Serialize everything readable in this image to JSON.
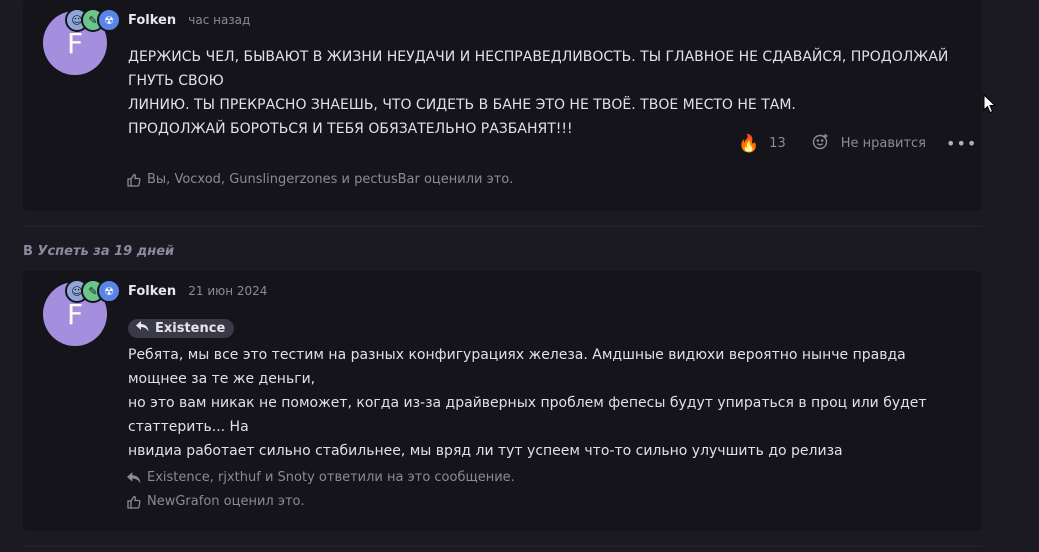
{
  "post1": {
    "avatar_letter": "F",
    "username": "Folken",
    "time": "час назад",
    "text_lines": [
      "ДЕРЖИСЬ ЧЕЛ, БЫВАЮТ В ЖИЗНИ НЕУДАЧИ И НЕСПРАВЕДЛИВОСТЬ. ТЫ ГЛАВНОЕ НЕ СДАВАЙСЯ, ПРОДОЛЖАЙ ГНУТЬ СВОЮ",
      "ЛИНИЮ. ТЫ ПРЕКРАСНО ЗНАЕШЬ, ЧТО СИДЕТЬ В БАНЕ ЭТО НЕ ТВОЁ. ТВОЕ МЕСТО НЕ ТАМ.",
      "ПРОДОЛЖАЙ БОРОТЬСЯ И ТЕБЯ ОБЯЗАТЕЛЬНО РАЗБАНЯТ!!!"
    ],
    "reaction_emoji": "🔥",
    "reaction_count": "13",
    "dislike_label": "Не нравится",
    "more_label": "•••",
    "liked_by": "Вы, Vocxod, Gunslingerzones и pectusBar оценили это."
  },
  "section": {
    "prefix": "В",
    "topic": "Успеть за 19 дней"
  },
  "post2": {
    "avatar_letter": "F",
    "username": "Folken",
    "time": "21 июн 2024",
    "quote_author": "Existence",
    "text_lines": [
      "Ребята, мы все это тестим на разных конфигурациях железа. Амдшные видюхи вероятно нынче правда мощнее за те же деньги,",
      "но это вам никак не поможет, когда из-за драйверных проблем фепесы будут упираться в проц или будет статтерить... На",
      "нвидиа работает сильно стабильнее, мы вряд ли тут успеем что-то сильно улучшить до релиза"
    ],
    "replied_by": "Existence, rjxthuf и Snoty ответили на это сообщение.",
    "liked_by": "NewGrafon оценил это."
  },
  "colors": {
    "background": "#1b1a22",
    "card": "#15141b",
    "avatar": "#a48fde",
    "muted": "#8a8a98"
  }
}
